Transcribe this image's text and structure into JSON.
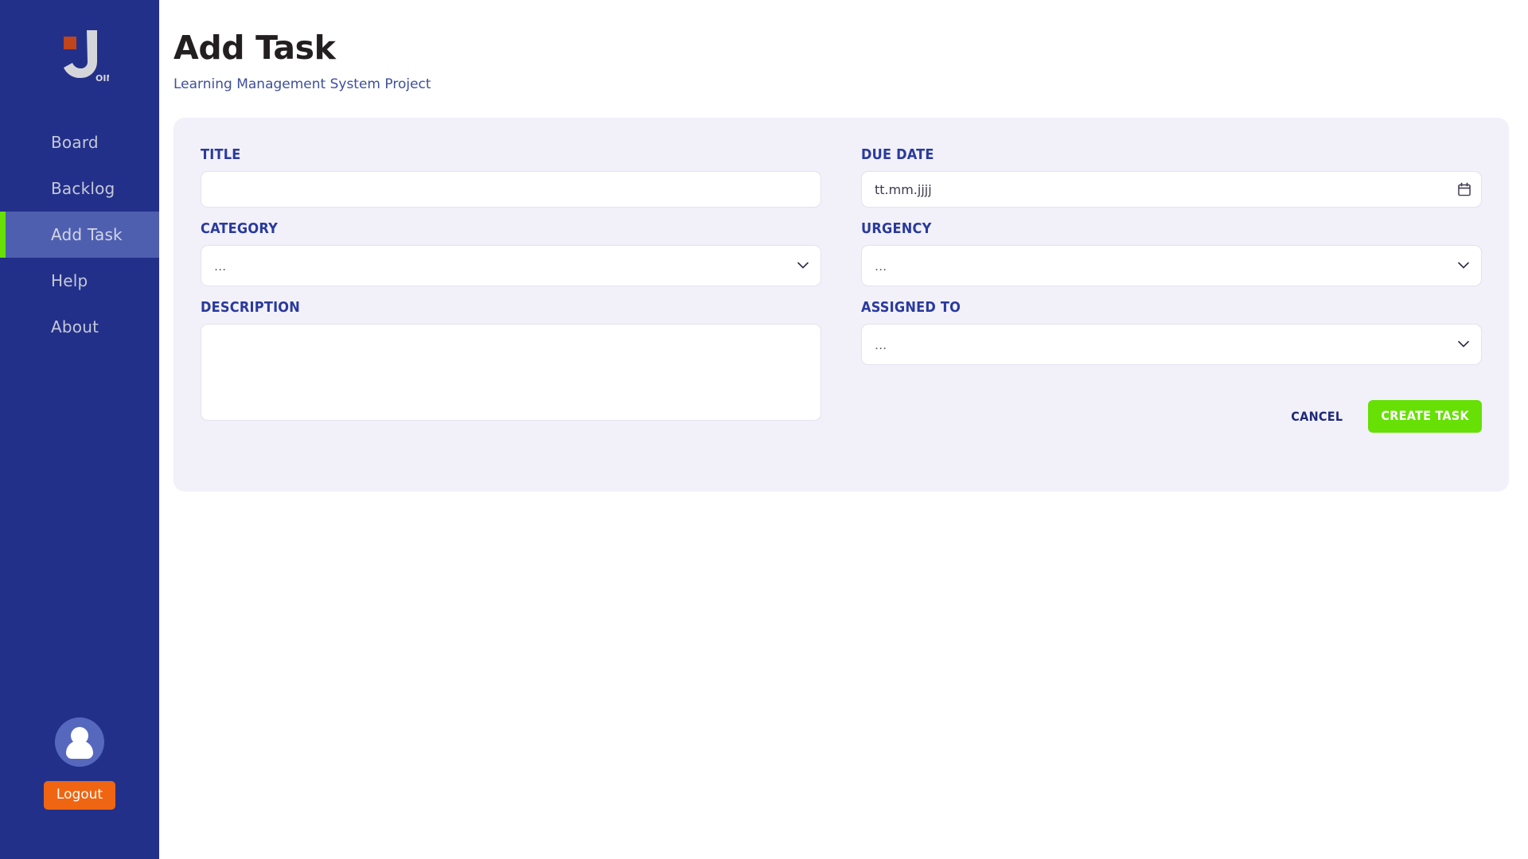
{
  "sidebar": {
    "logo": {
      "icon": "join-logo-icon",
      "mark": "J",
      "suffix": "OIN",
      "accent_color": "#c0451b"
    },
    "items": [
      {
        "label": "Board",
        "active": false
      },
      {
        "label": "Backlog",
        "active": false
      },
      {
        "label": "Add Task",
        "active": true
      },
      {
        "label": "Help",
        "active": false
      },
      {
        "label": "About",
        "active": false
      }
    ],
    "active_indicator_color": "#66e005",
    "active_bg_color": "#4f5fb0",
    "bg_color": "#23308a",
    "avatar": {
      "icon": "user-avatar-icon"
    },
    "logout_label": "Logout",
    "logout_color": "#f06511"
  },
  "header": {
    "title": "Add Task",
    "subtitle": "Learning Management System Project"
  },
  "form": {
    "card_bg": "#f2f1fa",
    "left": {
      "title": {
        "label": "TITLE",
        "value": "",
        "placeholder": ""
      },
      "category": {
        "label": "CATEGORY",
        "value": "...",
        "options": [
          "..."
        ]
      },
      "description": {
        "label": "DESCRIPTION",
        "value": "",
        "placeholder": ""
      }
    },
    "right": {
      "due_date": {
        "label": "DUE DATE",
        "value": "",
        "placeholder": "tt.mm.jjjj",
        "icon": "calendar-icon"
      },
      "urgency": {
        "label": "URGENCY",
        "value": "...",
        "options": [
          "..."
        ]
      },
      "assigned_to": {
        "label": "ASSIGNED TO",
        "value": "...",
        "options": [
          "..."
        ]
      }
    }
  },
  "actions": {
    "cancel_label": "CANCEL",
    "create_label": "CREATE TASK",
    "create_color": "#66e005"
  }
}
